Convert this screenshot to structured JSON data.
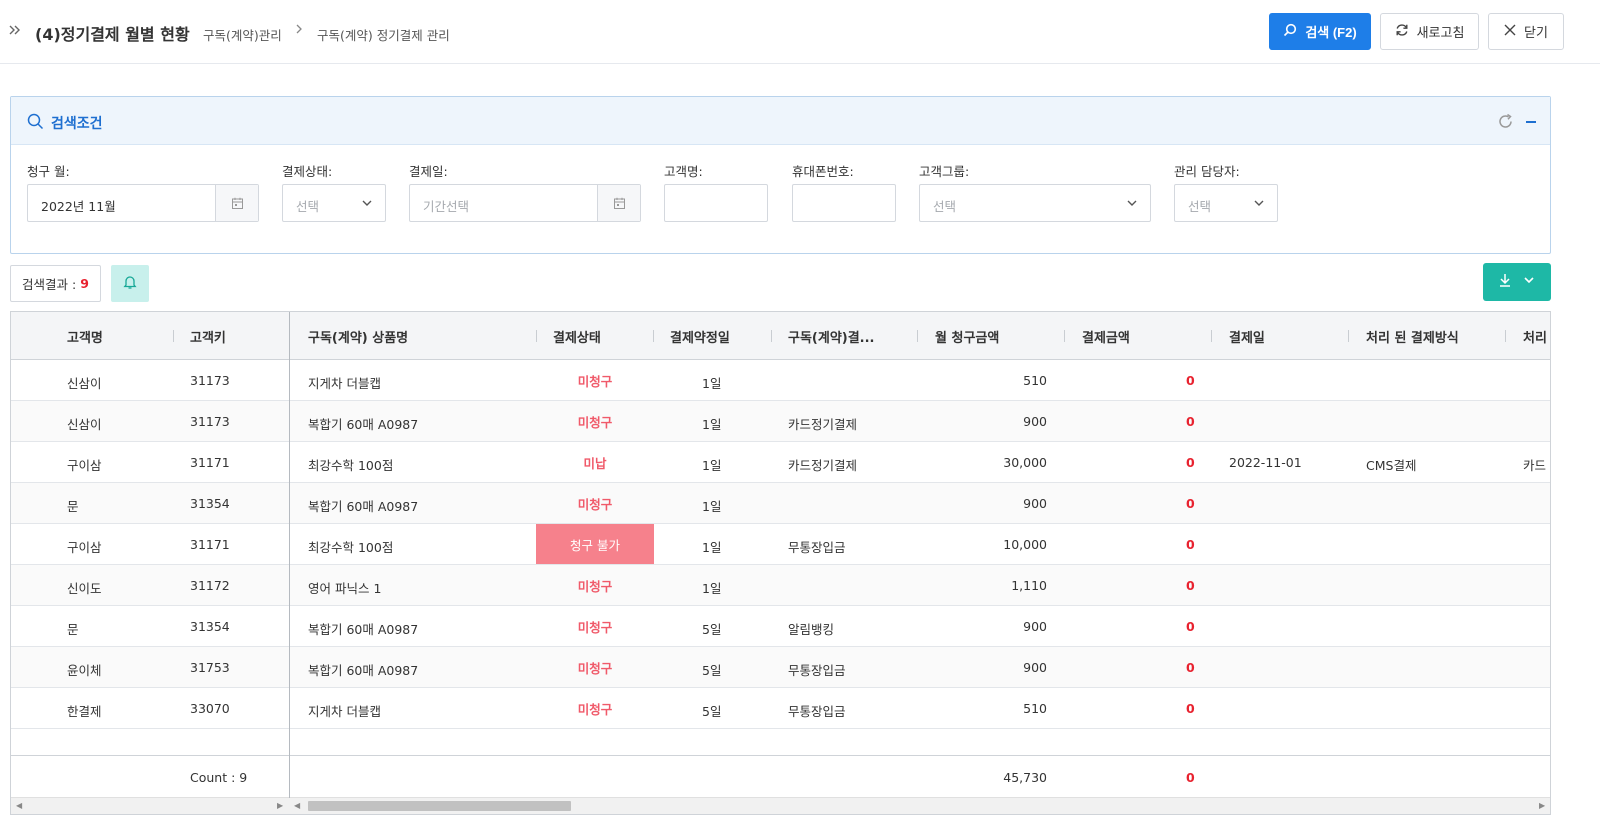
{
  "header": {
    "title": "(4)정기결제 월별 현황",
    "breadcrumb": [
      "구독(계약)관리",
      "구독(계약) 정기결제 관리"
    ],
    "buttons": {
      "search": "검색 (F2)",
      "refresh": "새로고침",
      "close": "닫기"
    }
  },
  "search": {
    "title": "검색조건",
    "fields": {
      "billing_month": {
        "label": "청구 월:",
        "value": "2022년 11월"
      },
      "payment_status": {
        "label": "결제상태:",
        "placeholder": "선택"
      },
      "payment_date": {
        "label": "결제일:",
        "placeholder": "기간선택"
      },
      "customer_name": {
        "label": "고객명:"
      },
      "phone": {
        "label": "휴대폰번호:"
      },
      "customer_group": {
        "label": "고객그룹:",
        "placeholder": "선택"
      },
      "manager": {
        "label": "관리 담당자:",
        "placeholder": "선택"
      }
    }
  },
  "results": {
    "label": "검색결과 :",
    "count": "9"
  },
  "grid": {
    "columns": [
      "고객명",
      "고객키",
      "구독(계약) 상품명",
      "결제상태",
      "결제약정일",
      "구독(계약)결...",
      "월 청구금액",
      "결제금액",
      "결제일",
      "처리 된 결제방식",
      "처리"
    ],
    "rows": [
      {
        "name": "신삼이",
        "key": "31173",
        "product": "지게차 더블캡",
        "status": "미청구",
        "due": "1일",
        "method": "",
        "billed": "510",
        "paid": "0",
        "pay_date": "",
        "processed": "",
        "extra": ""
      },
      {
        "name": "신삼이",
        "key": "31173",
        "product": "복합기 60매 A0987",
        "status": "미청구",
        "due": "1일",
        "method": "카드정기결제",
        "billed": "900",
        "paid": "0",
        "pay_date": "",
        "processed": "",
        "extra": ""
      },
      {
        "name": "구이삼",
        "key": "31171",
        "product": "최강수학 100점",
        "status": "미납",
        "due": "1일",
        "method": "카드정기결제",
        "billed": "30,000",
        "paid": "0",
        "pay_date": "2022-11-01",
        "processed": "CMS결제",
        "extra": "카드"
      },
      {
        "name": "문",
        "key": "31354",
        "product": "복합기 60매 A0987",
        "status": "미청구",
        "due": "1일",
        "method": "",
        "billed": "900",
        "paid": "0",
        "pay_date": "",
        "processed": "",
        "extra": ""
      },
      {
        "name": "구이삼",
        "key": "31171",
        "product": "최강수학 100점",
        "status": "청구 불가",
        "due": "1일",
        "method": "무통장입금",
        "billed": "10,000",
        "paid": "0",
        "pay_date": "",
        "processed": "",
        "extra": ""
      },
      {
        "name": "신이도",
        "key": "31172",
        "product": "영어 파닉스 1",
        "status": "미청구",
        "due": "1일",
        "method": "",
        "billed": "1,110",
        "paid": "0",
        "pay_date": "",
        "processed": "",
        "extra": ""
      },
      {
        "name": "문",
        "key": "31354",
        "product": "복합기 60매 A0987",
        "status": "미청구",
        "due": "5일",
        "method": "알림뱅킹",
        "billed": "900",
        "paid": "0",
        "pay_date": "",
        "processed": "",
        "extra": ""
      },
      {
        "name": "윤이체",
        "key": "31753",
        "product": "복합기 60매 A0987",
        "status": "미청구",
        "due": "5일",
        "method": "무통장입금",
        "billed": "900",
        "paid": "0",
        "pay_date": "",
        "processed": "",
        "extra": ""
      },
      {
        "name": "한결제",
        "key": "33070",
        "product": "지게차 더블캡",
        "status": "미청구",
        "due": "5일",
        "method": "무통장입금",
        "billed": "510",
        "paid": "0",
        "pay_date": "",
        "processed": "",
        "extra": ""
      }
    ],
    "footer": {
      "count": "Count : 9",
      "billed_total": "45,730",
      "paid_total": "0"
    }
  },
  "colors": {
    "primary": "#1e7ee8",
    "accent_teal": "#1eb8a6",
    "danger": "#e8222f",
    "status_text": "#f05a6a",
    "status_blocked_bg": "#f6818c"
  }
}
